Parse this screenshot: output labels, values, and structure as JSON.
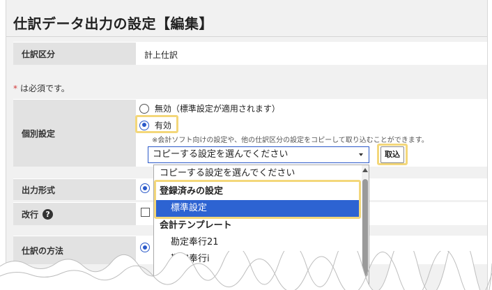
{
  "page_title": "仕訳データ出力の設定【編集】",
  "journal_type": {
    "label": "仕訳区分",
    "value": "計上仕訳"
  },
  "required_note": {
    "star": "*",
    "text": "は必須です。"
  },
  "individual": {
    "label": "個別設定",
    "option_disabled": "無効（標準設定が適用されます）",
    "option_enabled": "有効",
    "hint": "※会計ソフト向けの設定や、他の仕訳区分の設定をコピーして取り込むことができます。",
    "select_value": "コピーする設定を選んでください",
    "import_button": "取込"
  },
  "output_format": {
    "label": "出力形式"
  },
  "line_break": {
    "label": "改行",
    "help": "?"
  },
  "journal_method": {
    "label": "仕訳の方法"
  },
  "dropdown": {
    "placeholder": "コピーする設定を選んでください",
    "group_registered": "登録済みの設定",
    "item_standard": "標準設定",
    "group_templates": "会計テンプレート",
    "item_bugyo21": "勘定奉行21",
    "item_bugyo_partial": "勘定奉行i"
  }
}
